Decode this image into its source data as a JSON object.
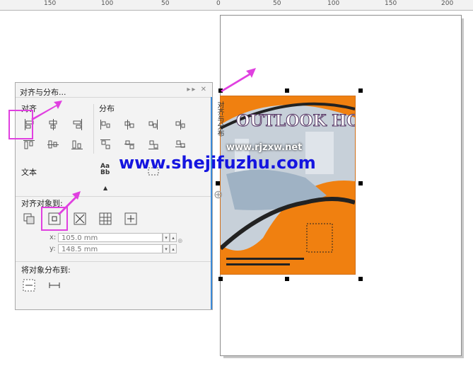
{
  "ruler": {
    "labels": [
      "150",
      "100",
      "50",
      "0",
      "50",
      "100",
      "150",
      "200"
    ]
  },
  "panel": {
    "title": "对齐与分布...",
    "controls": "▸▸ ✕",
    "align_label": "对齐",
    "distribute_label": "分布",
    "text_label": "文本",
    "align_to_label": "对齐对象到:",
    "distribute_to_label": "将对象分布到:",
    "x_label": "x:",
    "x_value": "105.0 mm",
    "y_label": "y:",
    "y_value": "148.5 mm",
    "sidebar_tab": "对齐与分布"
  },
  "poster": {
    "headline": "OUTLOOK HOME",
    "footer_text": "www.shejifuzhu.com"
  },
  "watermark": {
    "small": "www.rjzxw.net",
    "large": "www.shejifuzhu.com"
  },
  "colors": {
    "accent_highlight": "#e040e0",
    "poster_orange": "#f08010",
    "watermark_blue": "#1515e0",
    "sidebar_blue": "#3c8ad8"
  }
}
